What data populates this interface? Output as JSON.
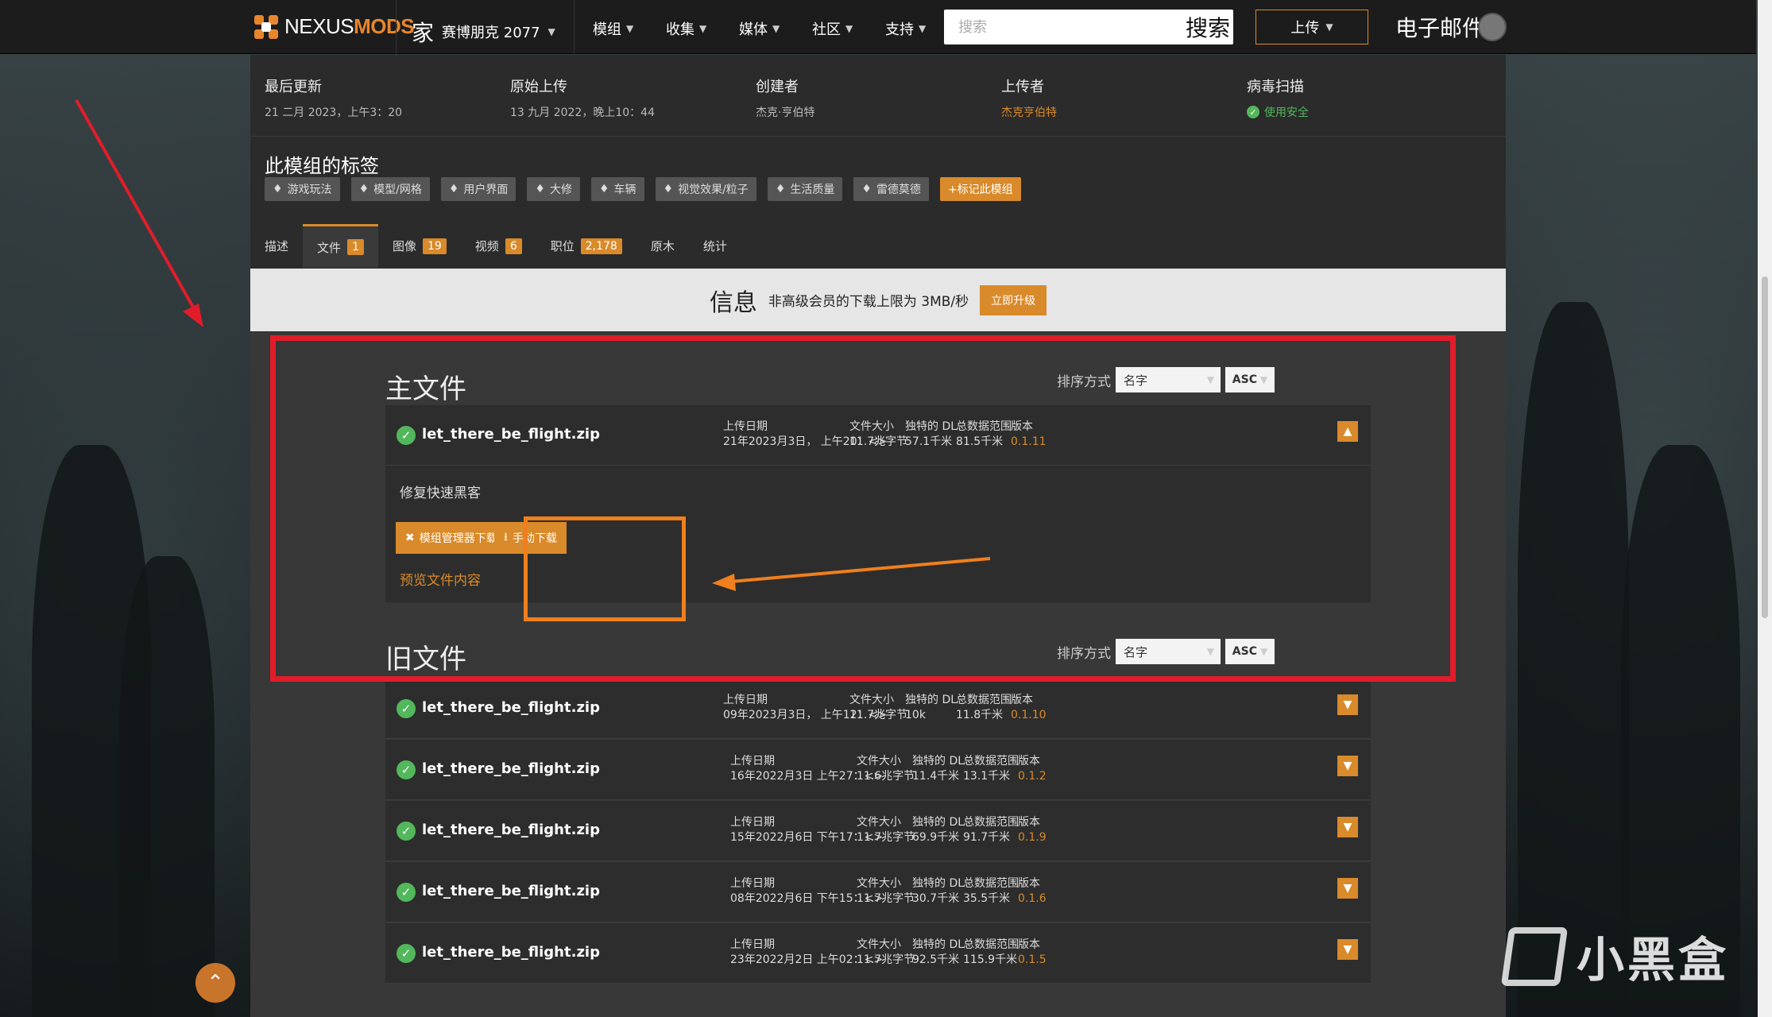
{
  "topbar": {
    "logo_prefix": "NEXUS",
    "logo_suffix": "MODS",
    "home_glyph": "家",
    "game_name": "赛博朋克 2077",
    "nav": [
      "模组",
      "收集",
      "媒体",
      "社区",
      "支持"
    ],
    "search_placeholder": "搜索",
    "search_button": "搜索",
    "upload_label": "上传",
    "user_text": "电子邮件"
  },
  "meta": [
    {
      "label": "最后更新",
      "value": "21 二月 2023，上午3：20"
    },
    {
      "label": "原始上传",
      "value": "13 九月 2022，晚上10：44"
    },
    {
      "label": "创建者",
      "value": "杰克·亨伯特"
    },
    {
      "label": "上传者",
      "value": "杰克亨伯特"
    },
    {
      "label": "病毒扫描",
      "value": "使用安全"
    }
  ],
  "tags": {
    "title": "此模组的标签",
    "items": [
      "游戏玩法",
      "模型/网格",
      "用户界面",
      "大修",
      "车辆",
      "视觉效果/粒子",
      "生活质量",
      "雷德莫德"
    ],
    "flag_label": "+标记此模组"
  },
  "tabs": [
    {
      "label": "描述",
      "badge": ""
    },
    {
      "label": "文件",
      "badge": "1"
    },
    {
      "label": "图像",
      "badge": "19"
    },
    {
      "label": "视频",
      "badge": "6"
    },
    {
      "label": "职位",
      "badge": "2,178"
    },
    {
      "label": "原木",
      "badge": ""
    },
    {
      "label": "统计",
      "badge": ""
    }
  ],
  "info_bar": {
    "title": "信息",
    "text": "非高级会员的下载上限为 3MB/秒",
    "button": "立即升级"
  },
  "stat_labels": {
    "upload_date": "上传日期",
    "file_size": "文件大小",
    "unique_dl": "独特的 DL",
    "total_dl": "总数据范围",
    "version": "版本"
  },
  "main_files": {
    "title": "主文件",
    "sort_label": "排序方式",
    "sort_value": "名字",
    "sort_dir": "ASC",
    "file": {
      "name": "let_there_be_flight.zip",
      "date": "21年2023月3日， 上午20：<>",
      "size": "11.7兆字节",
      "unique_dl": "57.1千米",
      "total_dl": "81.5千米",
      "version": "0.1.11"
    },
    "detail": {
      "description": "修复快速黑客",
      "mod_manager_btn": "模组管理器下载",
      "manual_btn": "手动下载",
      "preview": "预览文件内容"
    }
  },
  "old_files": {
    "title": "旧文件",
    "sort_label": "排序方式",
    "sort_value": "名字",
    "sort_dir": "ASC",
    "rows": [
      {
        "name": "let_there_be_flight.zip",
        "date": "09年2023月3日， 上午12：<>",
        "size": "11.7兆字节",
        "unique_dl": "10k",
        "total_dl": "11.8千米",
        "version": "0.1.10"
      },
      {
        "name": "let_there_be_flight.zip",
        "date": "16年2022月3日 上午27：<>",
        "size": "11.6兆字节",
        "unique_dl": "11.4千米",
        "total_dl": "13.1千米",
        "version": "0.1.2"
      },
      {
        "name": "let_there_be_flight.zip",
        "date": "15年2022月6日 下午17：<>",
        "size": "11.7兆字节",
        "unique_dl": "69.9千米",
        "total_dl": "91.7千米",
        "version": "0.1.9"
      },
      {
        "name": "let_there_be_flight.zip",
        "date": "08年2022月6日 下午15：<>",
        "size": "11.7兆字节",
        "unique_dl": "30.7千米",
        "total_dl": "35.5千米",
        "version": "0.1.6"
      },
      {
        "name": "let_there_be_flight.zip",
        "date": "23年2022月2日 上午02：<>",
        "size": "11.7兆字节",
        "unique_dl": "92.5千米",
        "total_dl": "115.9千米",
        "version": "0.1.5"
      }
    ]
  },
  "watermark": "小黑盒",
  "colors": {
    "accent": "#d98a2a",
    "safe": "#53b75c",
    "annotation_red": "#e11d2a",
    "annotation_orange": "#f07f1d"
  },
  "icons": [
    "nexus-logo-icon",
    "chevron-down-icon",
    "tag-icon",
    "check-circle-icon",
    "mod-manager-icon",
    "download-icon",
    "arrow-up-icon"
  ]
}
